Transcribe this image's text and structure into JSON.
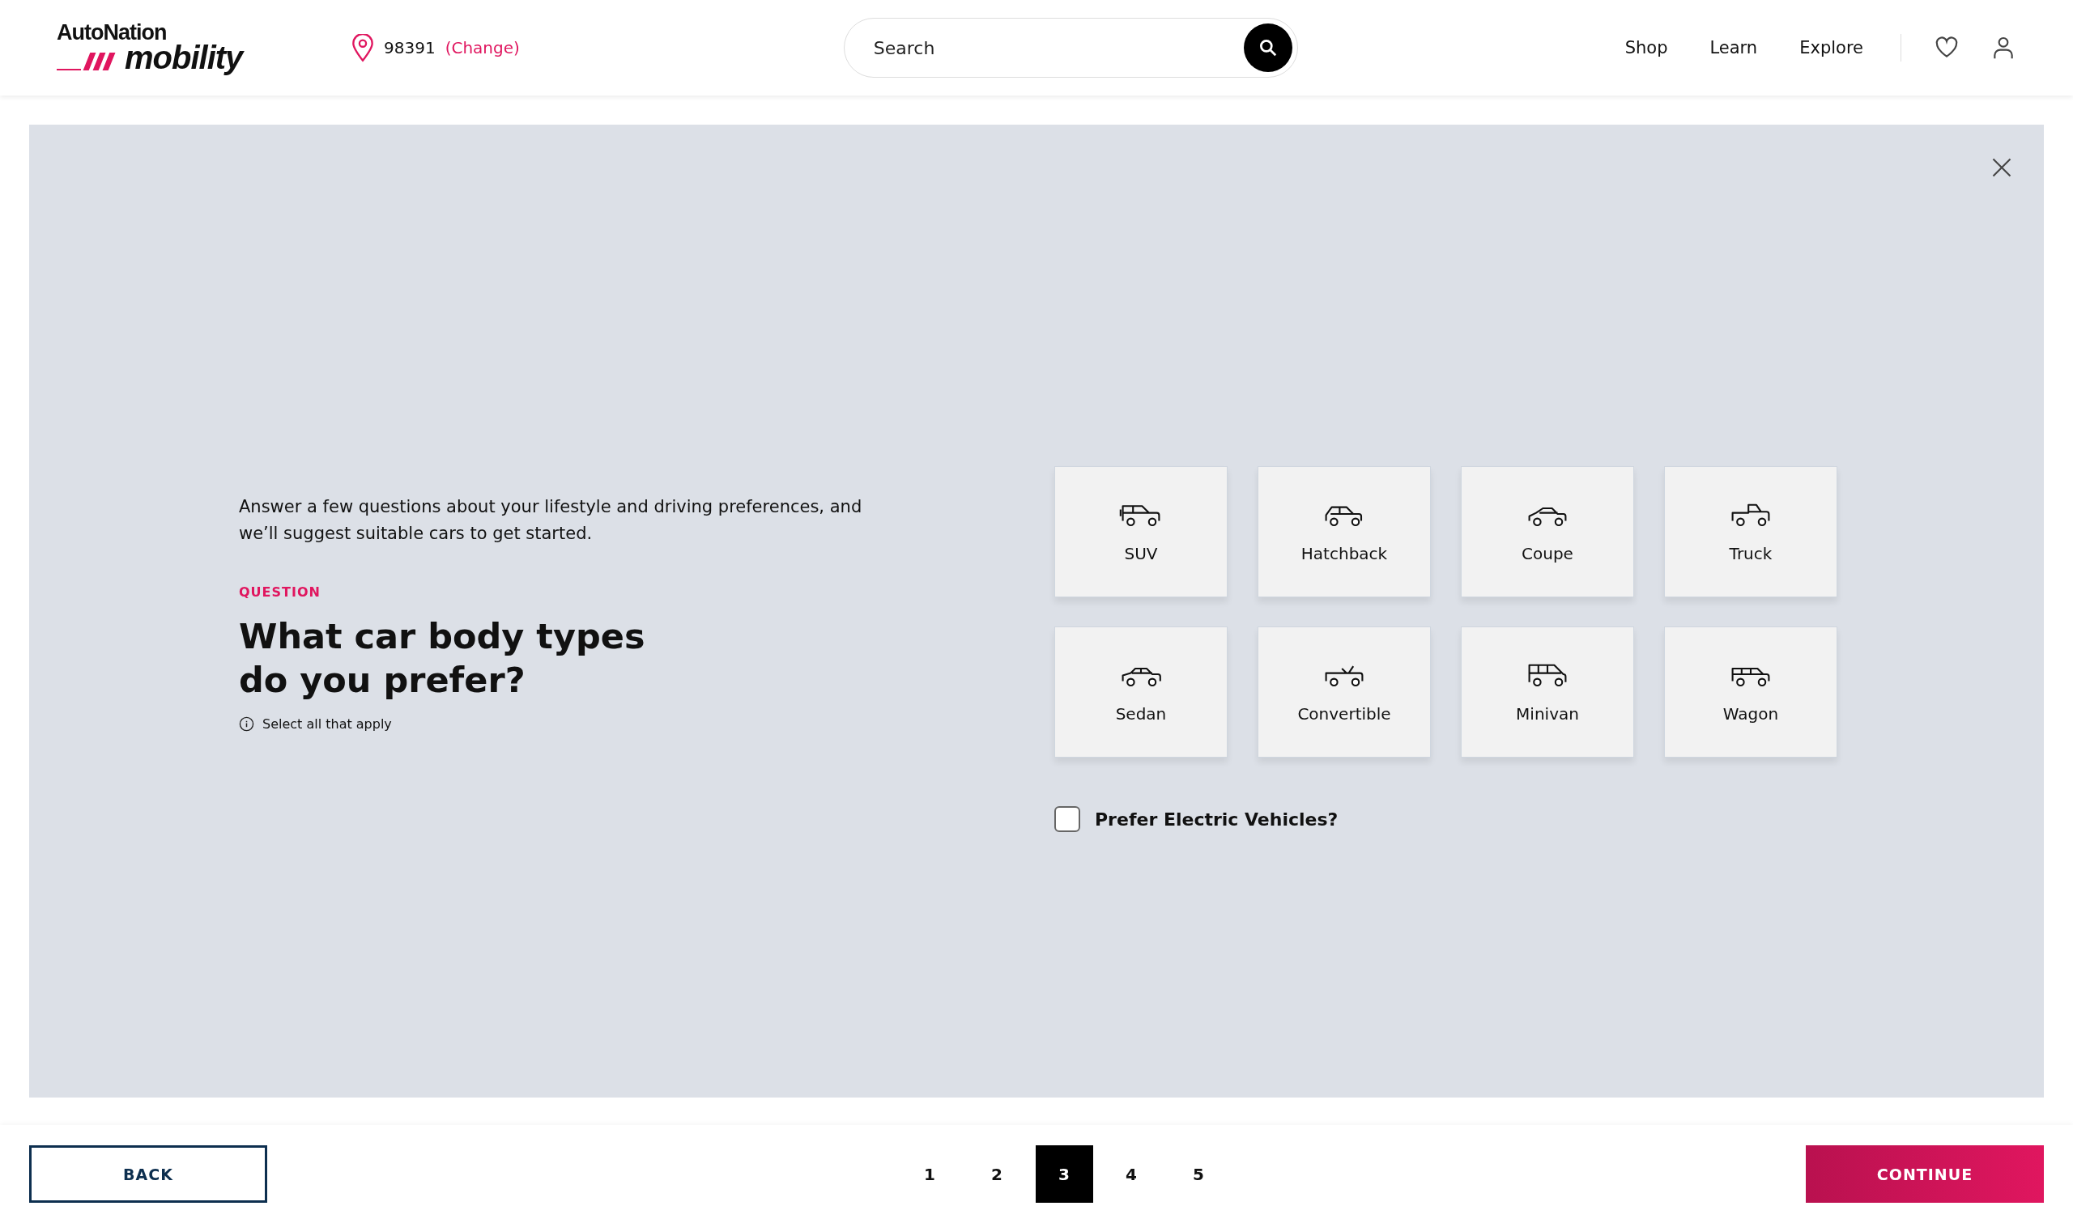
{
  "header": {
    "logo": {
      "top": "AutoNation",
      "bottom": "mobility"
    },
    "location": {
      "zip": "98391",
      "change": "(Change)"
    },
    "search": {
      "placeholder": "Search"
    },
    "nav": [
      "Shop",
      "Learn",
      "Explore"
    ]
  },
  "intro": "Answer a few questions about your lifestyle and driving preferences, and we’ll suggest suitable cars to get started.",
  "question": {
    "label": "QUESTION",
    "title": "What car body types do you prefer?",
    "hint": "Select all that apply"
  },
  "options": [
    {
      "label": "SUV",
      "kind": "suv",
      "selected": false
    },
    {
      "label": "Hatchback",
      "kind": "hatchback",
      "selected": false
    },
    {
      "label": "Coupe",
      "kind": "coupe",
      "selected": false
    },
    {
      "label": "Truck",
      "kind": "truck",
      "selected": false
    },
    {
      "label": "Sedan",
      "kind": "sedan",
      "selected": false
    },
    {
      "label": "Convertible",
      "kind": "convertible",
      "selected": false
    },
    {
      "label": "Minivan",
      "kind": "minivan",
      "selected": false
    },
    {
      "label": "Wagon",
      "kind": "wagon",
      "selected": false
    }
  ],
  "electric": {
    "label": "Prefer Electric Vehicles?",
    "checked": false
  },
  "footer": {
    "back": "BACK",
    "continue": "CONTINUE",
    "pages": [
      {
        "label": "1",
        "selected": false
      },
      {
        "label": "2",
        "selected": false
      },
      {
        "label": "3",
        "selected": true
      },
      {
        "label": "4",
        "selected": false
      },
      {
        "label": "5",
        "selected": false
      }
    ]
  }
}
